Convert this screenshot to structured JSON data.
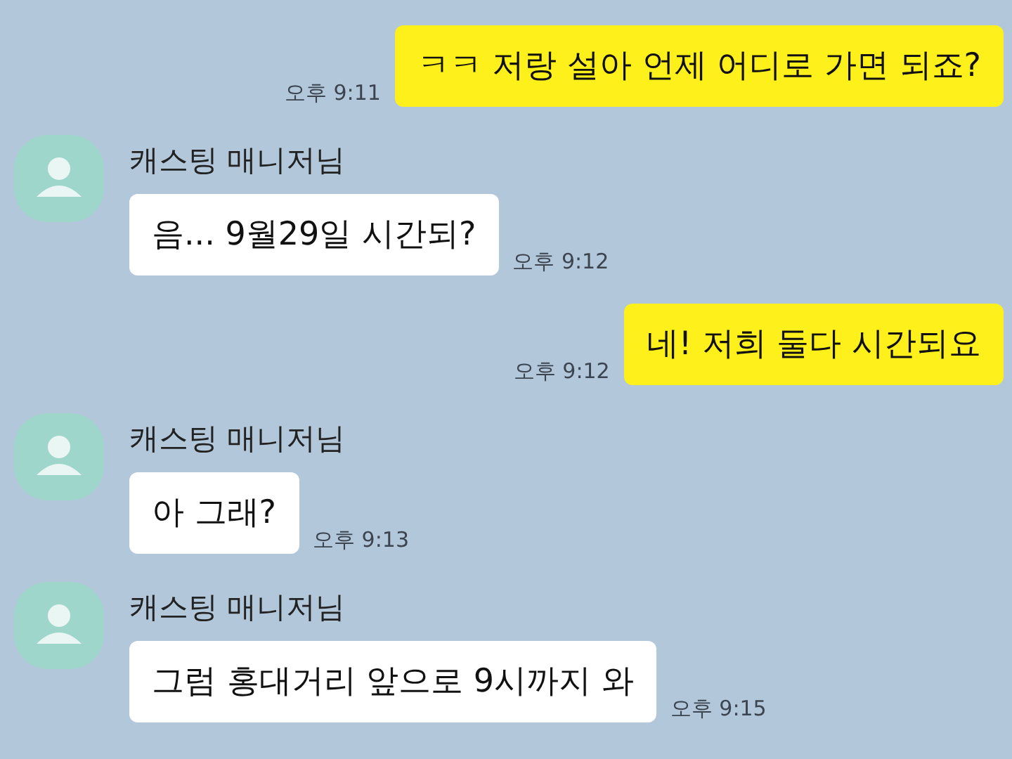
{
  "messages": [
    {
      "kind": "outgoing",
      "text": "ㅋㅋ 저랑 설아 언제 어디로 가면 되죠?",
      "time": "오후 9:11"
    },
    {
      "kind": "incoming",
      "sender": "캐스팅 매니저님",
      "text": "음... 9월29일 시간되?",
      "time": "오후 9:12"
    },
    {
      "kind": "outgoing",
      "text": "네! 저희 둘다 시간되요",
      "time": "오후 9:12"
    },
    {
      "kind": "incoming",
      "sender": "캐스팅 매니저님",
      "text": "아 그래?",
      "time": "오후 9:13"
    },
    {
      "kind": "incoming",
      "sender": "캐스팅 매니저님",
      "text": "그럼 홍대거리 앞으로 9시까지 와",
      "time": "오후 9:15"
    }
  ]
}
